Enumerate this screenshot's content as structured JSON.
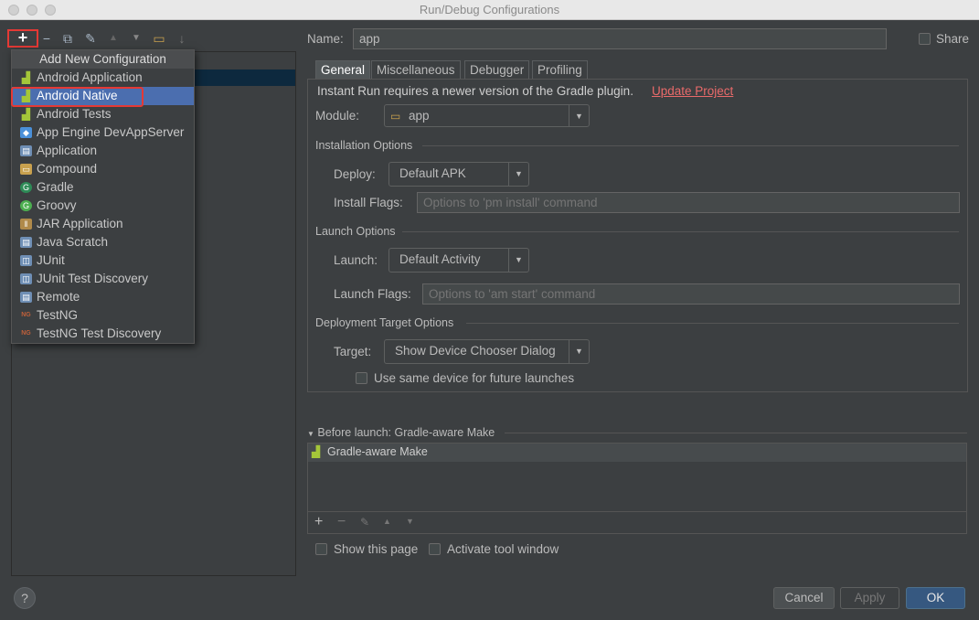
{
  "window": {
    "title": "Run/Debug Configurations"
  },
  "left_toolbar": {
    "add": "+",
    "remove": "−",
    "copy": "⧉",
    "edit_defaults": "✎",
    "move_up": "▲",
    "move_down": "▼",
    "folder": "▭",
    "sort": "↓"
  },
  "popup": {
    "header": "Add New Configuration",
    "items": [
      {
        "label": "Android Application",
        "icon": "android-icon",
        "glyph": "",
        "color": "#a4c639"
      },
      {
        "label": "Android Native",
        "icon": "android-icon",
        "glyph": "",
        "color": "#a4c639"
      },
      {
        "label": "Android Tests",
        "icon": "android-icon",
        "glyph": "",
        "color": "#a4c639"
      },
      {
        "label": "App Engine DevAppServer",
        "icon": "app-engine-icon",
        "glyph": "◆",
        "color": "#4a90d9"
      },
      {
        "label": "Application",
        "icon": "application-icon",
        "glyph": "▤",
        "color": "#6f8fb5"
      },
      {
        "label": "Compound",
        "icon": "folder-icon",
        "glyph": "▭",
        "color": "#c9a14e"
      },
      {
        "label": "Gradle",
        "icon": "gradle-icon",
        "glyph": "G",
        "color": "#2e8b57"
      },
      {
        "label": "Groovy",
        "icon": "groovy-icon",
        "glyph": "G",
        "color": "#4caf50"
      },
      {
        "label": "JAR Application",
        "icon": "jar-icon",
        "glyph": "‖",
        "color": "#b08a4a"
      },
      {
        "label": "Java Scratch",
        "icon": "java-scratch-icon",
        "glyph": "▤",
        "color": "#6f8fb5"
      },
      {
        "label": "JUnit",
        "icon": "junit-icon",
        "glyph": "◫",
        "color": "#6f8fb5"
      },
      {
        "label": "JUnit Test Discovery",
        "icon": "junit-discovery-icon",
        "glyph": "◫",
        "color": "#6f8fb5"
      },
      {
        "label": "Remote",
        "icon": "remote-icon",
        "glyph": "▤",
        "color": "#6f8fb5"
      },
      {
        "label": "TestNG",
        "icon": "testng-icon",
        "glyph": "NG",
        "color": "#c0603a"
      },
      {
        "label": "TestNG Test Discovery",
        "icon": "testng-discovery-icon",
        "glyph": "NG",
        "color": "#c0603a"
      }
    ],
    "selected_label": "Android Native"
  },
  "name": {
    "label": "Name:",
    "value": "app"
  },
  "share": {
    "label": "Share",
    "checked": false
  },
  "tabs": [
    {
      "label": "General",
      "active": true
    },
    {
      "label": "Miscellaneous",
      "active": false
    },
    {
      "label": "Debugger",
      "active": false
    },
    {
      "label": "Profiling",
      "active": false
    }
  ],
  "general": {
    "instant_run_text": "Instant Run requires a newer version of the Gradle plugin.",
    "update_link": "Update Project",
    "module_label": "Module:",
    "module_value": "app",
    "installation_title": "Installation Options",
    "deploy_label": "Deploy:",
    "deploy_value": "Default APK",
    "install_flags_label": "Install Flags:",
    "install_flags_placeholder": "Options to 'pm install' command",
    "launch_title": "Launch Options",
    "launch_label": "Launch:",
    "launch_value": "Default Activity",
    "launch_flags_label": "Launch Flags:",
    "launch_flags_placeholder": "Options to 'am start' command",
    "deployment_title": "Deployment Target Options",
    "target_label": "Target:",
    "target_value": "Show Device Chooser Dialog",
    "same_device_label": "Use same device for future launches",
    "same_device_checked": false
  },
  "before_launch": {
    "title": "Before launch: Gradle-aware Make",
    "tasks": [
      "Gradle-aware Make"
    ],
    "toolbar": {
      "add": "+",
      "remove": "−",
      "edit": "✎",
      "up": "▲",
      "down": "▼"
    }
  },
  "show_page": {
    "label": "Show this page",
    "checked": false
  },
  "activate_tool": {
    "label": "Activate tool window",
    "checked": false
  },
  "buttons": {
    "help": "?",
    "cancel": "Cancel",
    "apply": "Apply",
    "ok": "OK"
  },
  "colors": {
    "link": "#e96a6a",
    "accent_blue": "#4b6eaf",
    "highlight_red": "#e53935",
    "android_green": "#a4c639"
  }
}
